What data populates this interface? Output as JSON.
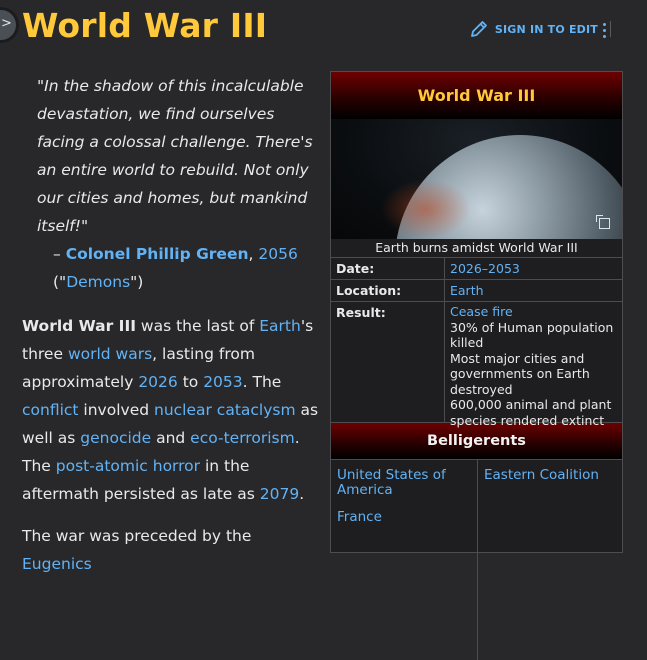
{
  "header": {
    "title": "World War III",
    "edit_label": "SIGN IN TO EDIT",
    "colors": {
      "title": "#ffc93a",
      "link": "#62b3f5",
      "background": "#28282b"
    }
  },
  "quote": {
    "text": "\"In the shadow of this incalculable devastation, we find ourselves facing a colossal challenge. There's an entire world to rebuild. Not only our cities and homes, but mankind itself!\"",
    "dash": "– ",
    "speaker": "Colonel Phillip Green",
    "comma": ", ",
    "year": "2056",
    "source_open": "(\"",
    "source": "Demons",
    "source_close": "\")"
  },
  "article": {
    "p1": [
      {
        "text": "World War III",
        "style": "bold"
      },
      {
        "text": " was the last of "
      },
      {
        "text": "Earth",
        "style": "link"
      },
      {
        "text": "'s three "
      },
      {
        "text": "world wars",
        "style": "link"
      },
      {
        "text": ", lasting from approximately "
      },
      {
        "text": "2026",
        "style": "link"
      },
      {
        "text": " to "
      },
      {
        "text": "2053",
        "style": "link"
      },
      {
        "text": ". The "
      },
      {
        "text": "conflict",
        "style": "link"
      },
      {
        "text": " involved "
      },
      {
        "text": "nuclear cataclysm",
        "style": "link"
      },
      {
        "text": " as well as "
      },
      {
        "text": "genocide",
        "style": "link"
      },
      {
        "text": " and "
      },
      {
        "text": "eco-terrorism",
        "style": "link"
      },
      {
        "text": ". The "
      },
      {
        "text": "post-atomic horror",
        "style": "link"
      },
      {
        "text": " in the aftermath persisted as late as "
      },
      {
        "text": "2079",
        "style": "link"
      },
      {
        "text": "."
      }
    ],
    "p2_start": "The war was preceded by the ",
    "p2_link": "Eugenics"
  },
  "infobox": {
    "title": "World War III",
    "caption": "Earth burns amidst World War III",
    "date_label": "Date:",
    "date_value": "2026–2053",
    "location_label": "Location:",
    "location_value": "Earth",
    "result_label": "Result:",
    "result_lines": [
      {
        "text": "Cease fire",
        "style": "link"
      },
      {
        "text": "30% of Human population killed"
      },
      {
        "text": "Most major cities and governments on Earth destroyed"
      },
      {
        "text": "600,000 animal and plant species rendered extinct"
      }
    ],
    "belligerents_label": "Belligerents",
    "side_a": [
      "United States of America",
      "France"
    ],
    "side_b": [
      "Eastern Coalition"
    ]
  }
}
